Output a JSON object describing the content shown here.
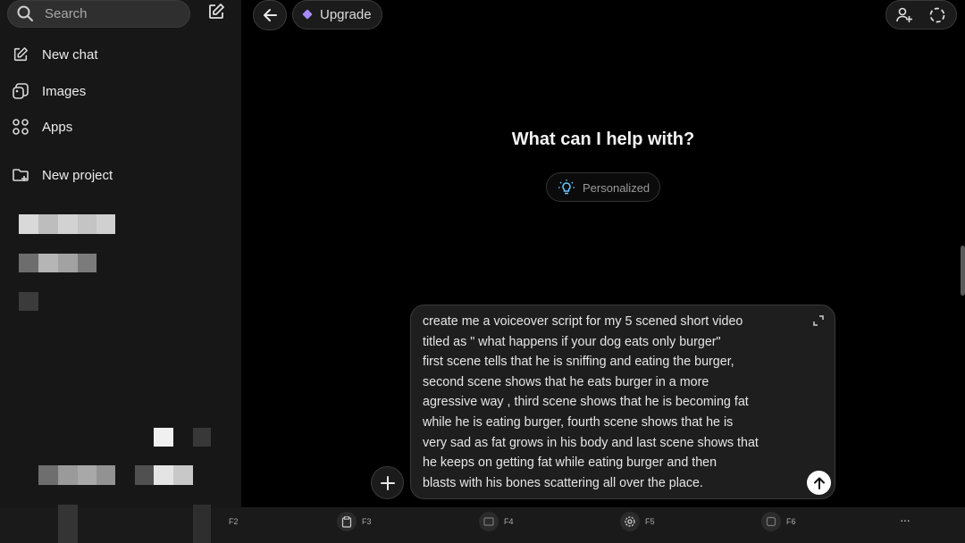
{
  "sidebar": {
    "search_label": "Search",
    "items": [
      {
        "label": "New chat",
        "icon": "new-chat-icon"
      },
      {
        "label": "Images",
        "icon": "images-icon"
      },
      {
        "label": "Apps",
        "icon": "apps-icon"
      },
      {
        "label": "New project",
        "icon": "folder-plus-icon"
      }
    ]
  },
  "topbar": {
    "upgrade_label": "Upgrade",
    "accent": "#a78bfa"
  },
  "main": {
    "headline": "What can I help with?",
    "personalized_label": "Personalized"
  },
  "composer": {
    "message": "create me a voiceover script for my 5 scened short video\ntitled as \" what happens if your dog eats only burger\"\nfirst scene tells that he is sniffing and eating the burger,\nsecond scene shows that he eats burger in a more\nagressive way , third scene shows that he is becoming fat\nwhile he is eating burger, fourth scene shows that he is\nvery sad as fat grows in his body and last scene shows that\nhe keeps on getting fat while eating burger and then\nblasts with his bones scattering all over the place."
  },
  "sysbar": {
    "keys": [
      {
        "label": "F2",
        "icon": "screen-icon"
      },
      {
        "label": "F3",
        "icon": "clipboard-icon"
      },
      {
        "label": "F4",
        "icon": "window-icon"
      },
      {
        "label": "F5",
        "icon": "settings-icon"
      },
      {
        "label": "F6",
        "icon": "capture-icon"
      }
    ],
    "more": "···"
  }
}
